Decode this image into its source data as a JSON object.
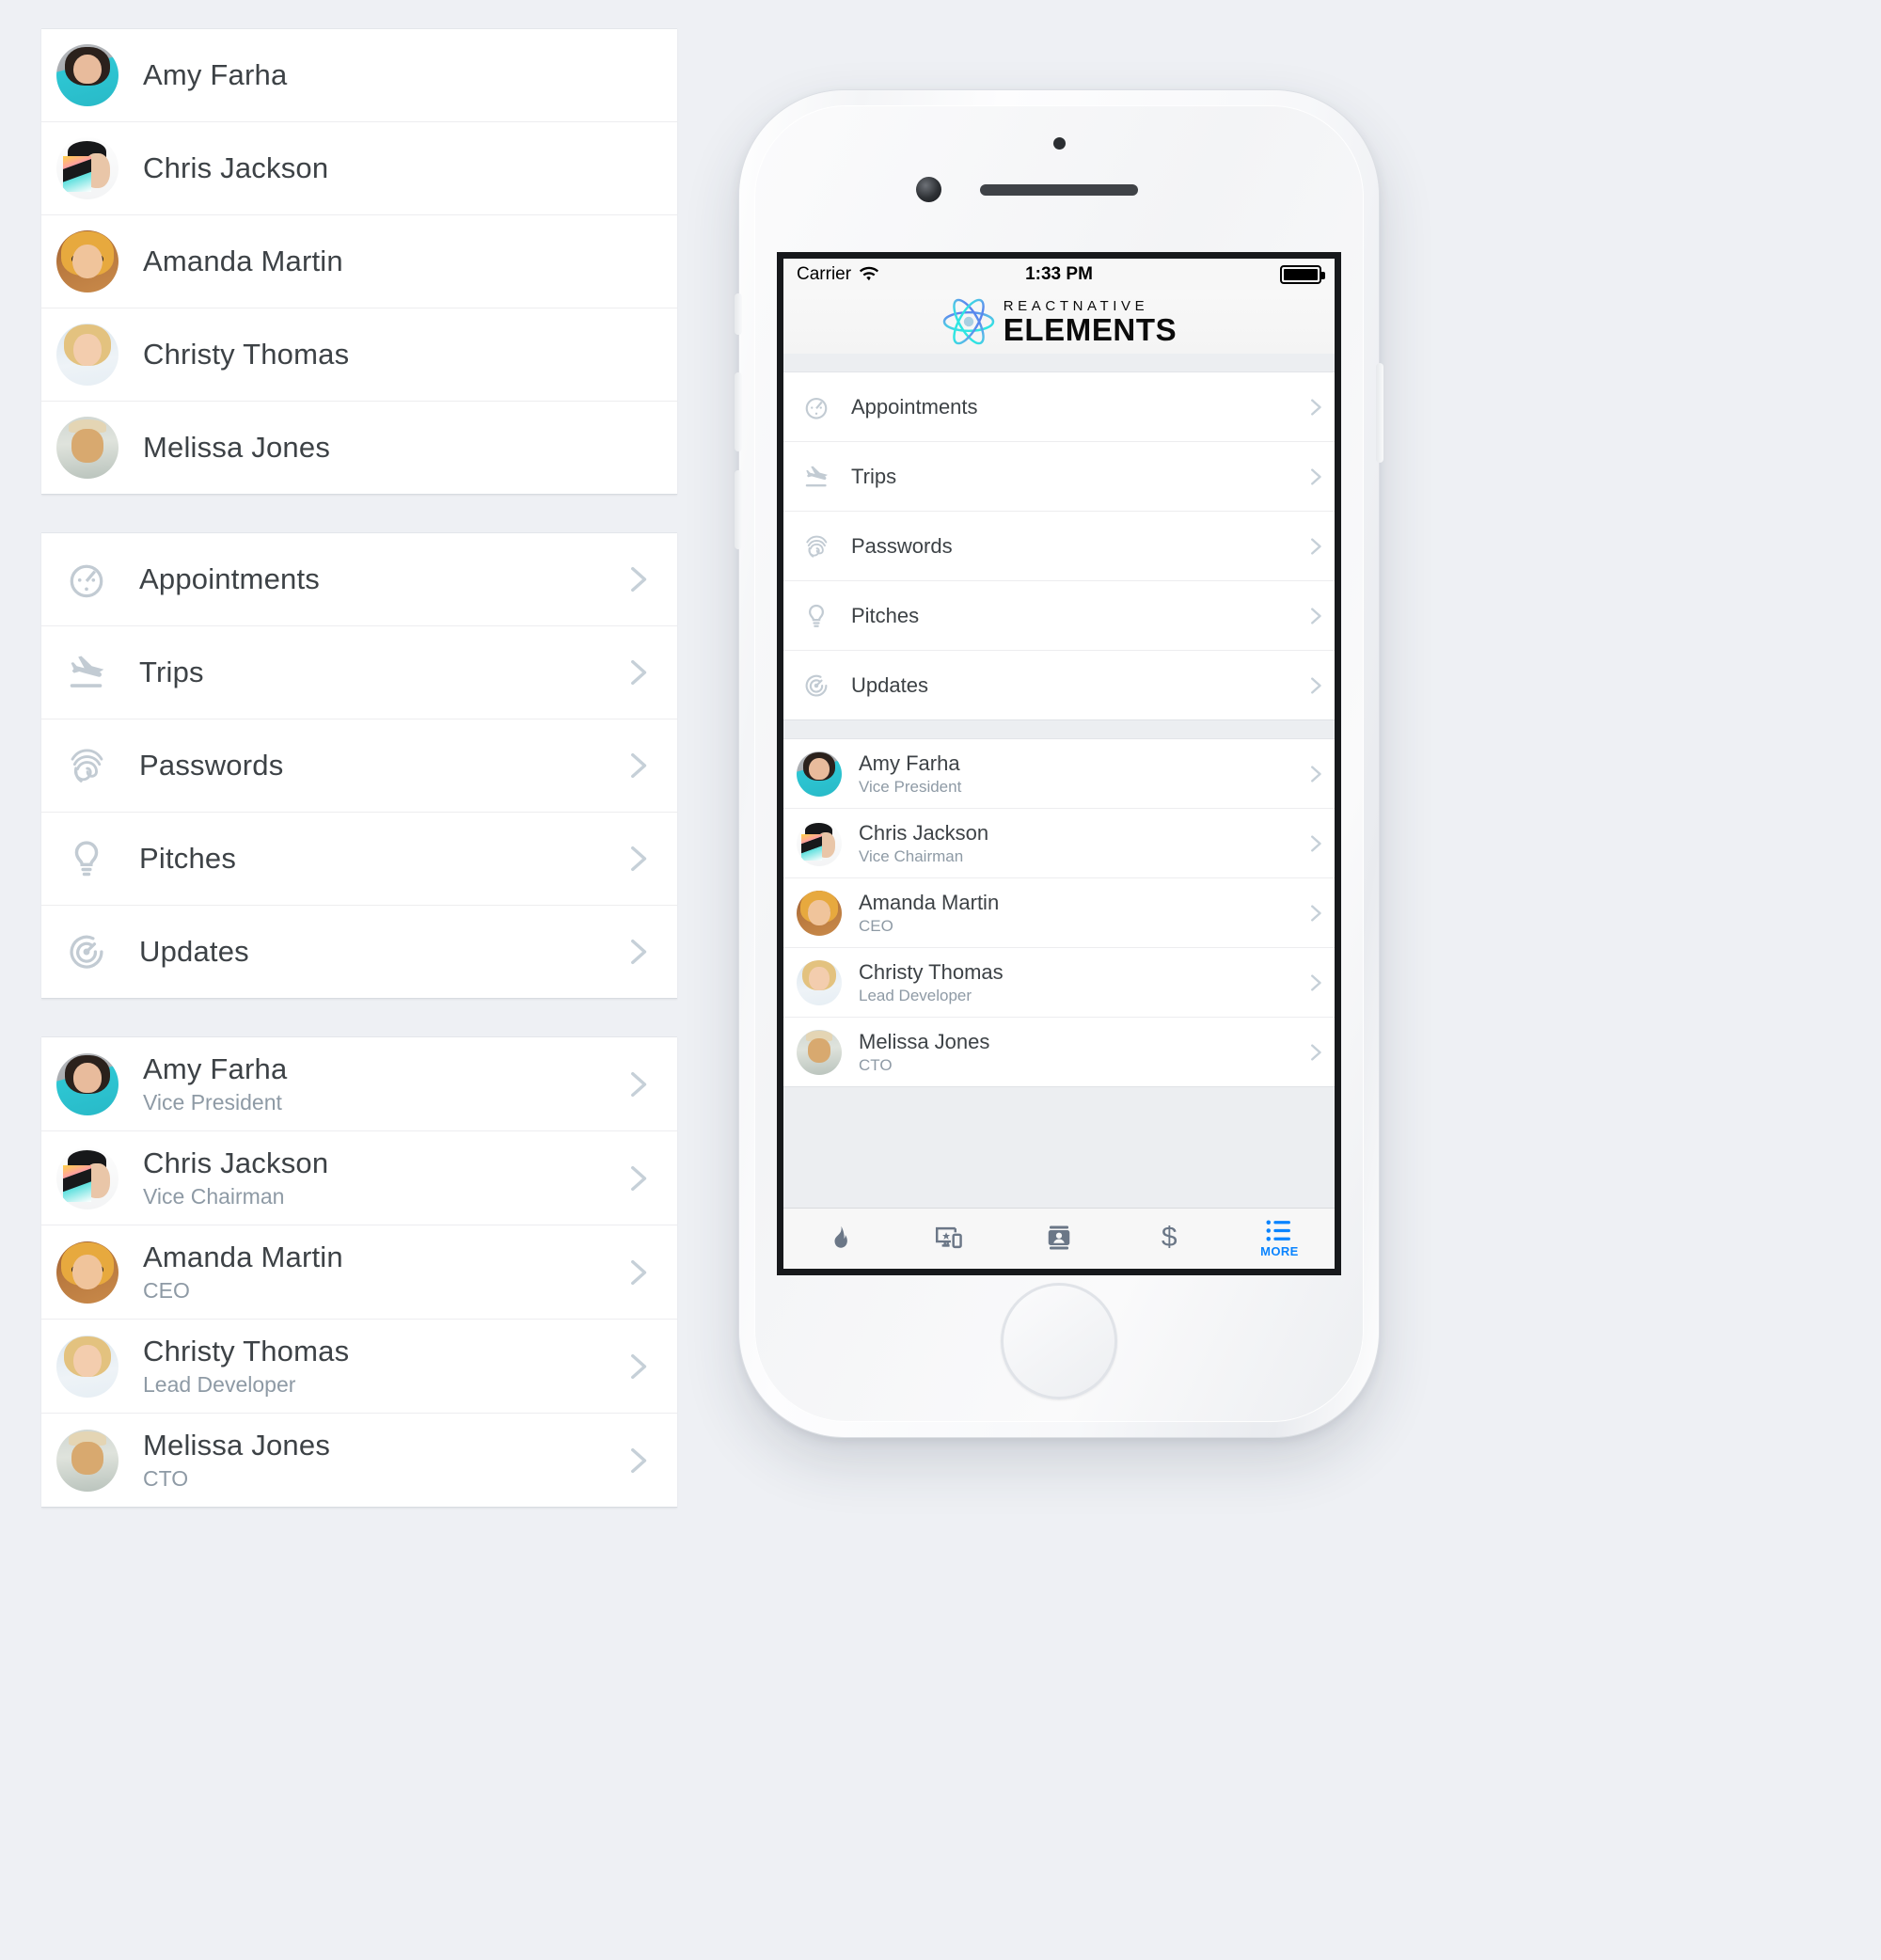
{
  "left_panel": {
    "contacts_simple": {
      "rows": [
        {
          "name": "Amy Farha",
          "avatar": "f-amy"
        },
        {
          "name": "Chris Jackson",
          "avatar": "f-chris"
        },
        {
          "name": "Amanda Martin",
          "avatar": "f-amanda"
        },
        {
          "name": "Christy Thomas",
          "avatar": "f-christy"
        },
        {
          "name": "Melissa Jones",
          "avatar": "f-melissa"
        }
      ]
    },
    "menu": {
      "rows": [
        {
          "label": "Appointments",
          "icon": "stopwatch-icon"
        },
        {
          "label": "Trips",
          "icon": "airplane-icon"
        },
        {
          "label": "Passwords",
          "icon": "fingerprint-icon"
        },
        {
          "label": "Pitches",
          "icon": "lightbulb-icon"
        },
        {
          "label": "Updates",
          "icon": "radar-icon"
        }
      ]
    },
    "contacts_detailed": {
      "rows": [
        {
          "name": "Amy Farha",
          "role": "Vice President",
          "avatar": "f-amy"
        },
        {
          "name": "Chris Jackson",
          "role": "Vice Chairman",
          "avatar": "f-chris"
        },
        {
          "name": "Amanda Martin",
          "role": "CEO",
          "avatar": "f-amanda"
        },
        {
          "name": "Christy Thomas",
          "role": "Lead Developer",
          "avatar": "f-christy"
        },
        {
          "name": "Melissa Jones",
          "role": "CTO",
          "avatar": "f-melissa"
        }
      ]
    }
  },
  "phone": {
    "status_bar": {
      "carrier": "Carrier",
      "wifi_icon": "wifi-icon",
      "time": "1:33 PM",
      "battery_icon": "battery-full-icon",
      "battery_level": 100
    },
    "header": {
      "logo_icon": "react-atom-icon",
      "logo_line1": "REACTNATIVE",
      "logo_line2": "ELEMENTS"
    },
    "menu": {
      "rows": [
        {
          "label": "Appointments",
          "icon": "stopwatch-icon"
        },
        {
          "label": "Trips",
          "icon": "airplane-icon"
        },
        {
          "label": "Passwords",
          "icon": "fingerprint-icon"
        },
        {
          "label": "Pitches",
          "icon": "lightbulb-icon"
        },
        {
          "label": "Updates",
          "icon": "radar-icon"
        }
      ]
    },
    "contacts": {
      "rows": [
        {
          "name": "Amy Farha",
          "role": "Vice President",
          "avatar": "f-amy"
        },
        {
          "name": "Chris Jackson",
          "role": "Vice Chairman",
          "avatar": "f-chris"
        },
        {
          "name": "Amanda Martin",
          "role": "CEO",
          "avatar": "f-amanda"
        },
        {
          "name": "Christy Thomas",
          "role": "Lead Developer",
          "avatar": "f-christy"
        },
        {
          "name": "Melissa Jones",
          "role": "CTO",
          "avatar": "f-melissa"
        }
      ]
    },
    "tabbar": {
      "items": [
        {
          "label": "",
          "icon": "flame-icon",
          "active": false
        },
        {
          "label": "",
          "icon": "cast-device-icon",
          "active": false
        },
        {
          "label": "",
          "icon": "contact-card-icon",
          "active": false
        },
        {
          "label": "",
          "icon": "dollar-icon",
          "active": false
        },
        {
          "label": "MORE",
          "icon": "list-icon",
          "active": true
        }
      ]
    }
  },
  "colors": {
    "accent": "#0a84ff",
    "icon_gray": "#c2cbd3",
    "tab_gray": "#6b7787",
    "title": "#3d4246",
    "subtitle": "#8e9aa5",
    "page_bg": "#eef0f4"
  }
}
